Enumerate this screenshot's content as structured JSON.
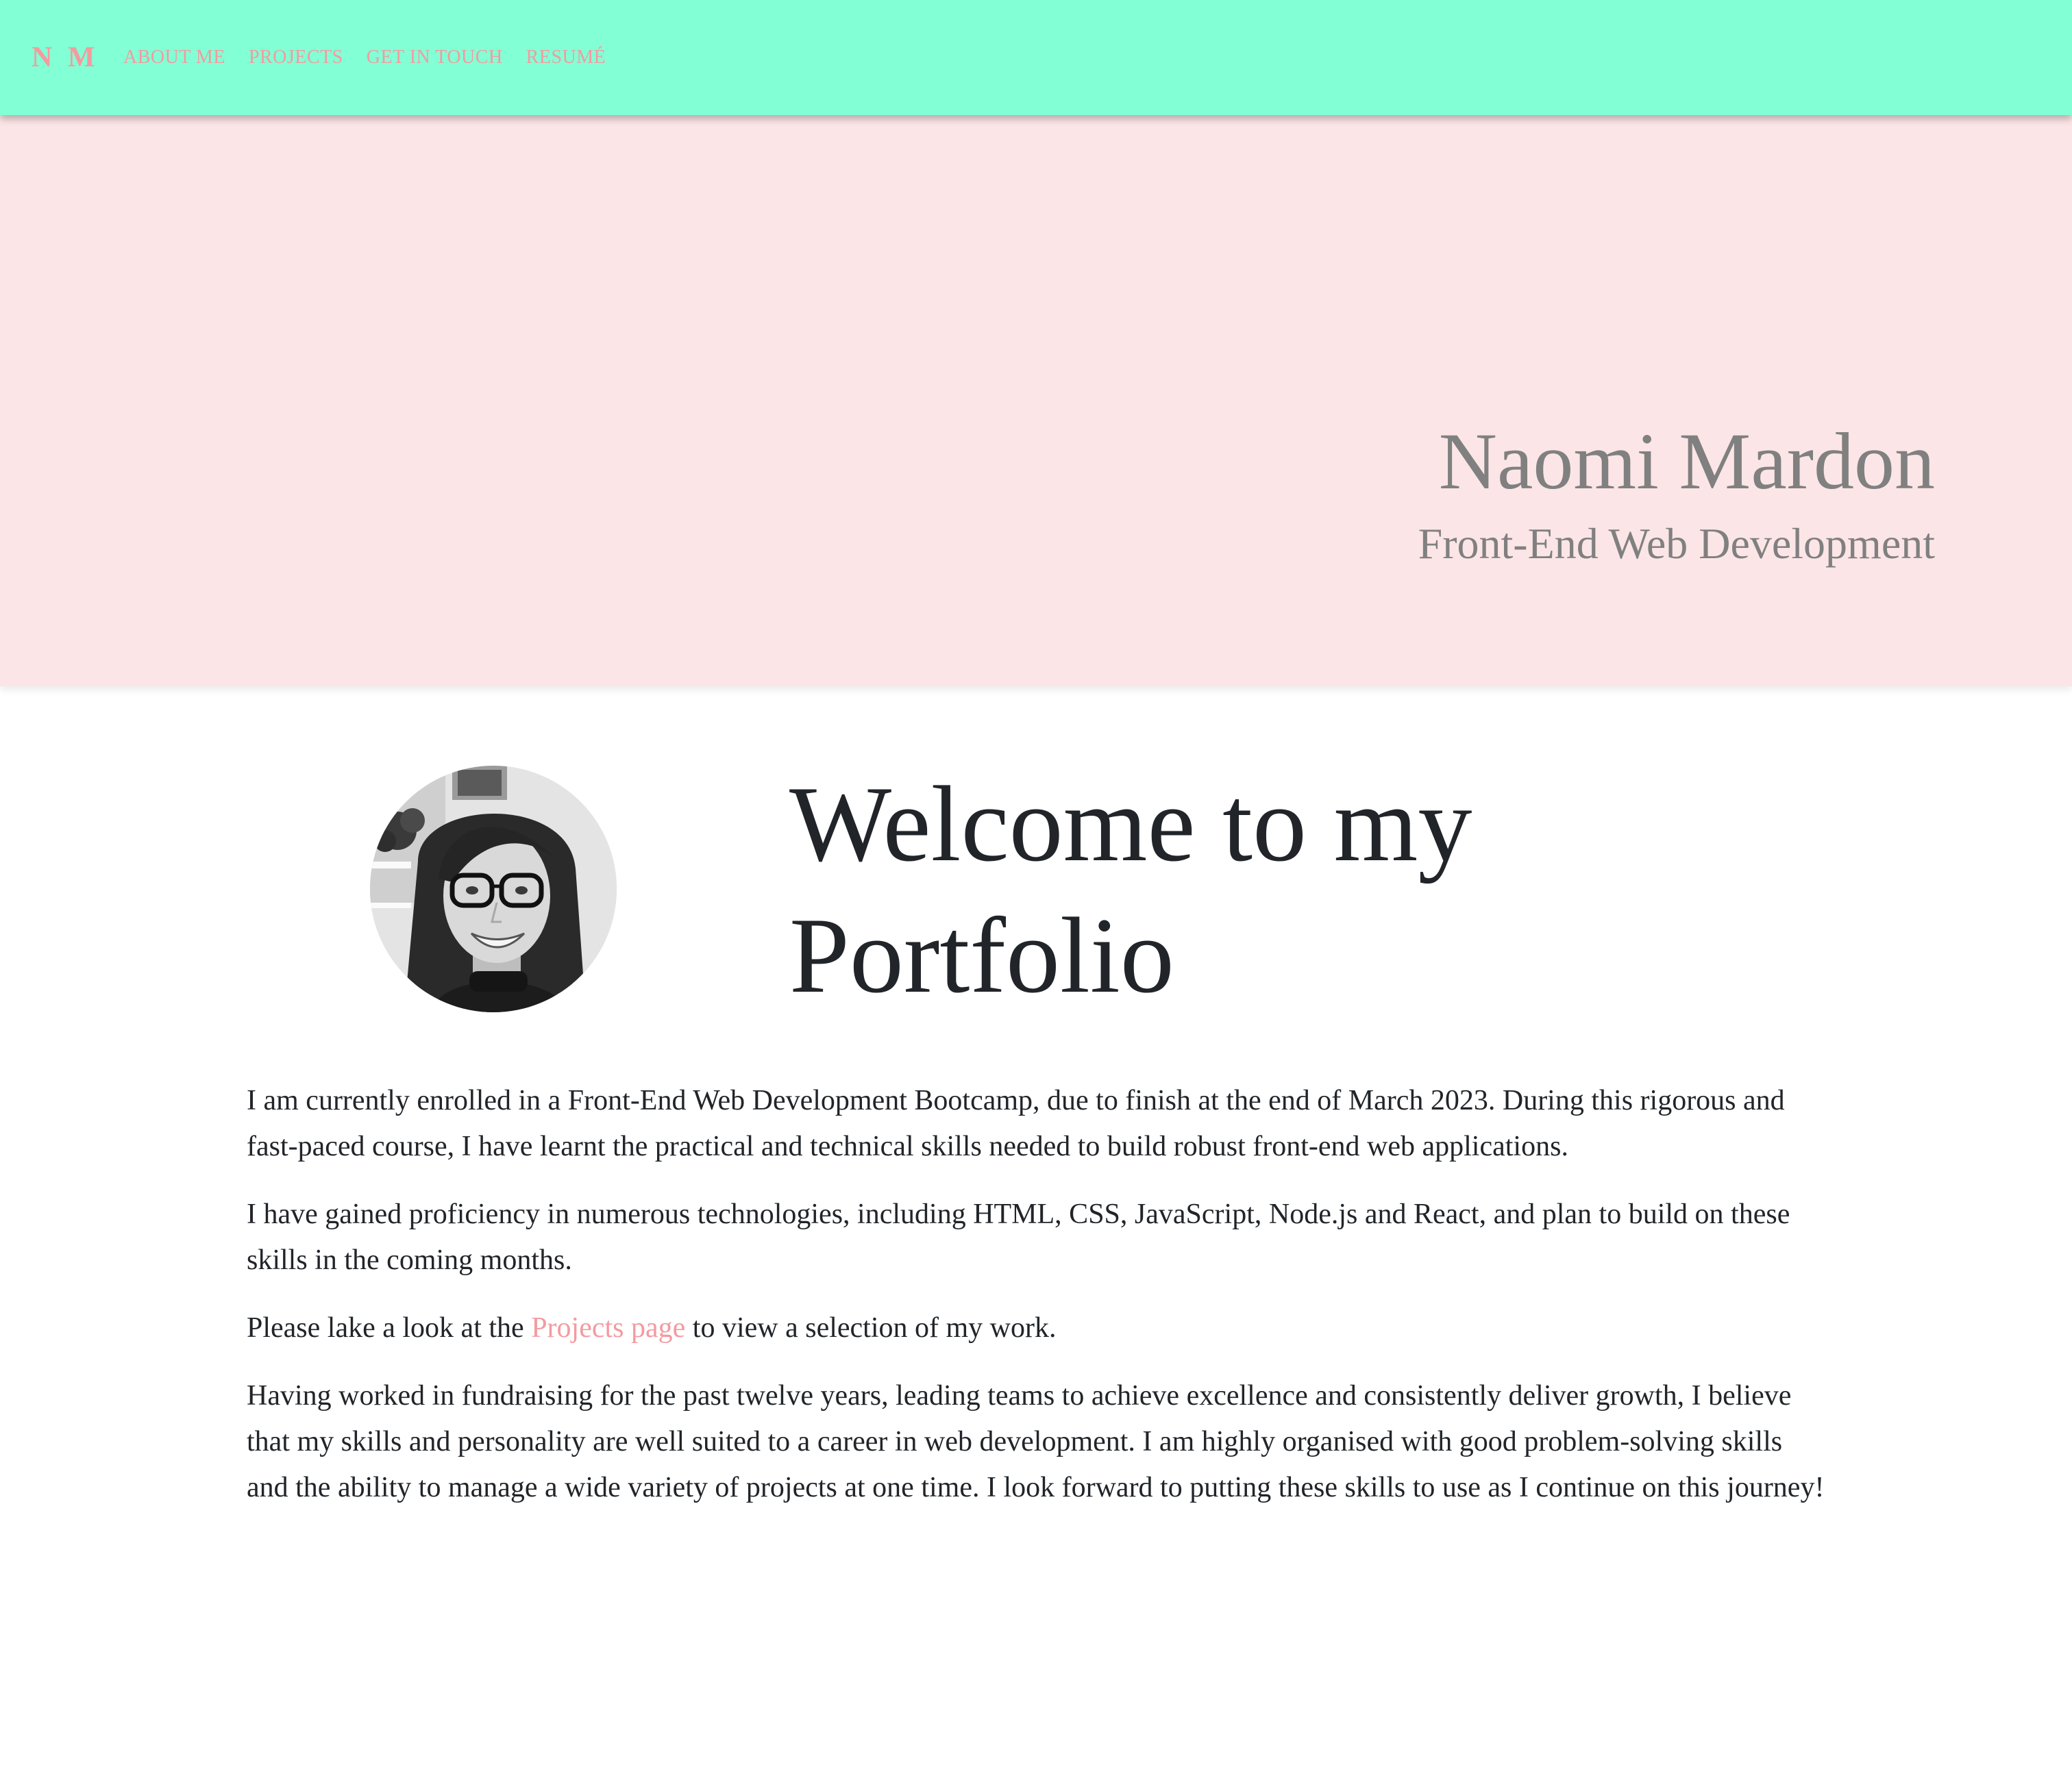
{
  "nav": {
    "brand": "N M",
    "links": [
      "ABOUT ME",
      "PROJECTS",
      "GET IN TOUCH",
      "RESUMÉ"
    ]
  },
  "hero": {
    "name": "Naomi Mardon",
    "subtitle": "Front-End Web Development"
  },
  "main": {
    "heading": "Welcome to my Portfolio",
    "paragraph1": "I am currently enrolled in a Front-End Web Development Bootcamp, due to finish at the end of March 2023. During this rigorous and fast-paced course, I have learnt the practical and technical skills needed to build robust front-end web applications.",
    "paragraph2": "I have gained proficiency in numerous technologies, including HTML, CSS, JavaScript, Node.js and React, and plan to build on these skills in the coming months.",
    "paragraph3_before": "Please lake a look at the ",
    "paragraph3_link": "Projects page",
    "paragraph3_after": " to view a selection of my work.",
    "paragraph4": "Having worked in fundraising for the past twelve years, leading teams to achieve excellence and consistently deliver growth, I believe that my skills and personality are well suited to a career in web development. I am highly organised with good problem-solving skills and the ability to manage a wide variety of projects at one time. I look forward to putting these skills to use as I continue on this journey!"
  },
  "colors": {
    "navbar_bg": "#83ffd5",
    "hero_bg": "#fce5e6",
    "accent_pink": "#f39ba0",
    "hero_text": "#808080",
    "body_text": "#212529"
  }
}
